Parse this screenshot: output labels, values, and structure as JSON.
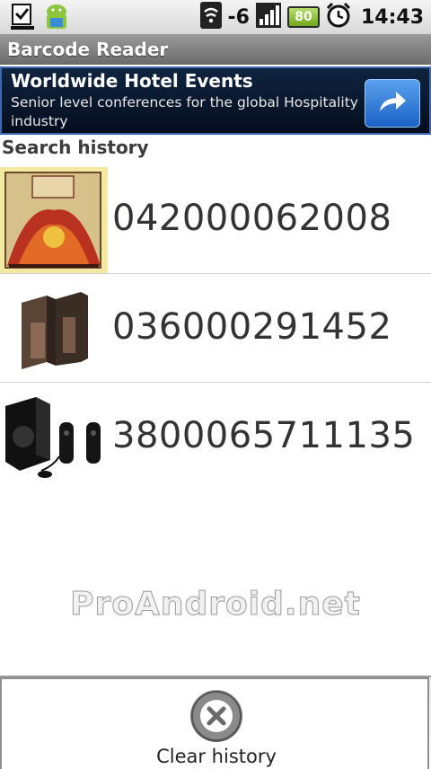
{
  "status_bar": {
    "signal_strength_text": "-6",
    "battery_level": "80",
    "time": "14:43",
    "icons": [
      "download-done-icon",
      "android-app-icon",
      "wifi-icon",
      "signal-bars-icon",
      "battery-icon",
      "alarm-clock-icon"
    ]
  },
  "app": {
    "title": "Barcode Reader"
  },
  "ad": {
    "title": "Worldwide Hotel Events",
    "body": "Senior level conferences for the global Hospitality industry",
    "button_icon": "share-arrow-icon"
  },
  "history": {
    "header": "Search history",
    "items": [
      {
        "code": "042000062008",
        "thumb": "album-cover-thumbnail"
      },
      {
        "code": "036000291452",
        "thumb": "product-thumbnail"
      },
      {
        "code": "3800065711135",
        "thumb": "speakers-thumbnail"
      }
    ]
  },
  "watermark": "ProAndroid.net",
  "menu": {
    "clear_history_label": "Clear history",
    "clear_icon": "close-circle-icon"
  },
  "colors": {
    "ad_bg": "#0b1a33",
    "ad_button": "#2f7fdc",
    "title_bar": "#858585"
  }
}
